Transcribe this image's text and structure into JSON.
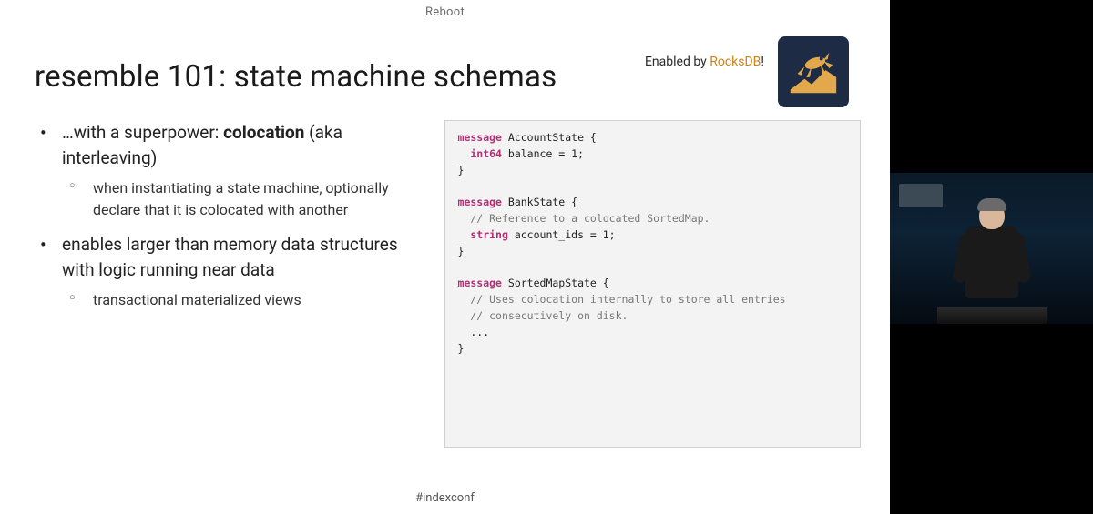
{
  "header": {
    "brand": "Reboot"
  },
  "enabled_by": {
    "prefix": "Enabled by ",
    "brand": "RocksDB",
    "suffix": "!"
  },
  "title": "resemble 101: state machine schemas",
  "bullets": {
    "item1_prefix": "…with a superpower: ",
    "item1_bold": "colocation",
    "item1_suffix": " (aka interleaving)",
    "item1_sub1": "when instantiating a state machine, optionally declare that it is colocated with another",
    "item2": "enables larger than memory data structures with logic running near data",
    "item2_sub1": "transactional materialized views"
  },
  "code": {
    "l1_kw": "message",
    "l1_name": " AccountState {",
    "l2_type": "  int64",
    "l2_rest": " balance = 1;",
    "l3": "}",
    "l4": "",
    "l5_kw": "message",
    "l5_name": " BankState {",
    "l6_comment": "  // Reference to a colocated SortedMap.",
    "l7_type": "  string",
    "l7_rest": " account_ids = 1;",
    "l8": "}",
    "l9": "",
    "l10_kw": "message",
    "l10_name": " SortedMapState {",
    "l11_comment": "  // Uses colocation internally to store all entries",
    "l12_comment": "  // consecutively on disk.",
    "l13": "  ...",
    "l14": "}"
  },
  "hashtag": "#indexconf"
}
